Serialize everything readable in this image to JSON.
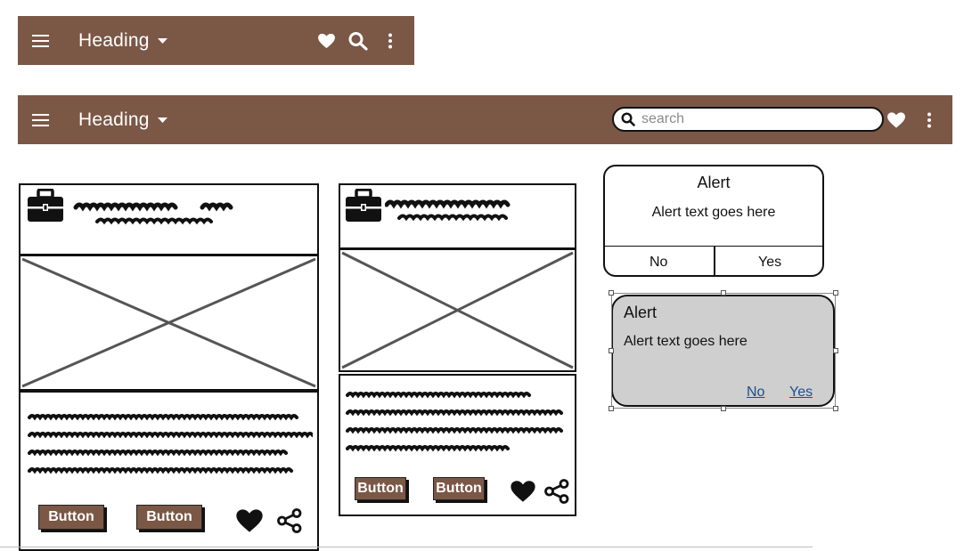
{
  "colors": {
    "appbar": "#7b5746",
    "alert_link": "#1d4f8c",
    "selected_alert_bg": "#cfcfcf"
  },
  "appbar_small": {
    "menu_icon": "hamburger-icon",
    "heading": "Heading",
    "dropdown_icon": "caret-down-icon",
    "actions": [
      "heart-icon",
      "search-icon",
      "more-vertical-icon"
    ]
  },
  "appbar_wide": {
    "menu_icon": "hamburger-icon",
    "heading": "Heading",
    "dropdown_icon": "caret-down-icon",
    "search_placeholder": "search",
    "actions": [
      "heart-icon",
      "more-vertical-icon"
    ]
  },
  "card_large": {
    "header_icon": "briefcase-icon",
    "button1": "Button",
    "button2": "Button",
    "actions": [
      "heart-icon",
      "share-icon"
    ]
  },
  "card_small": {
    "header_icon": "briefcase-icon",
    "button1": "Button",
    "button2": "Button",
    "actions": [
      "heart-icon",
      "share-icon"
    ]
  },
  "alert_dialog": {
    "title": "Alert",
    "text": "Alert text goes here",
    "no": "No",
    "yes": "Yes"
  },
  "alert_selected": {
    "title": "Alert",
    "text": "Alert text goes here",
    "no": "No",
    "yes": "Yes"
  }
}
